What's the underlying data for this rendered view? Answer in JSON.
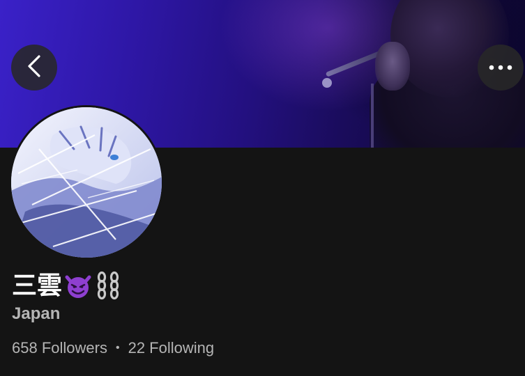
{
  "header": {
    "back_icon": "chevron-left-icon",
    "more_icon": "more-horizontal-icon"
  },
  "profile": {
    "display_name": "三雲",
    "name_emojis": [
      "smiling-devil-emoji",
      "chains-emoji"
    ],
    "location": "Japan",
    "followers_count": "658",
    "followers_label": "Followers",
    "following_count": "22",
    "following_label": "Following",
    "separator": "•"
  },
  "colors": {
    "background": "#141414",
    "secondary_text": "#b5b5b5",
    "banner_accent": "#2e17a6",
    "button_bg": "#282828"
  }
}
